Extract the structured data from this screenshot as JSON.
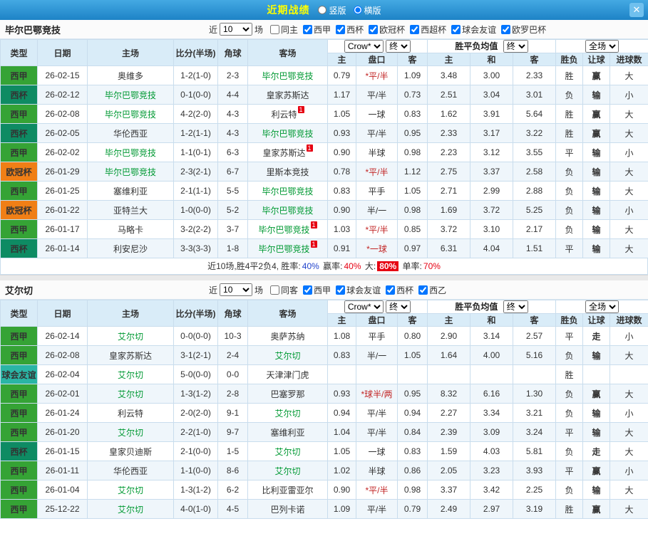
{
  "topbar": {
    "title": "近期战绩",
    "radios": [
      {
        "label": "竖版",
        "selected": false
      },
      {
        "label": "横版",
        "selected": true
      }
    ],
    "close_glyph": "✕"
  },
  "card_badge_text": "1",
  "colors": {
    "accent_blue": "#2491d6",
    "title_yellow": "#ffff00",
    "score_red": "#e60012",
    "focus_green": "#009933",
    "draw_blue": "#2244cc",
    "league": {
      "西甲": "#35a335",
      "西杯": "#0e8b63",
      "欧冠杯": "#f07f16",
      "球会友谊": "#2ab5a5"
    }
  },
  "filter_words": {
    "near": "近",
    "matches": "场"
  },
  "table_header": {
    "type": "类型",
    "date": "日期",
    "home": "主场",
    "score": "比分(半场)",
    "corner": "角球",
    "away": "客场",
    "odds_source": "Crow*",
    "final1": "终",
    "odds_cols": [
      "主",
      "盘口",
      "客"
    ],
    "avg_title": "胜平负均值",
    "final2": "终",
    "avg_cols": [
      "主",
      "和",
      "客"
    ],
    "scope": "全场",
    "result_cols": [
      "胜负",
      "让球",
      "进球数"
    ]
  },
  "sections": [
    {
      "team": "毕尔巴鄂竞技",
      "count": "10",
      "checkboxes": [
        {
          "label": "同主",
          "checked": false
        },
        {
          "label": "西甲",
          "checked": true
        },
        {
          "label": "西杯",
          "checked": true
        },
        {
          "label": "欧冠杯",
          "checked": true
        },
        {
          "label": "西超杯",
          "checked": true
        },
        {
          "label": "球会友谊",
          "checked": true
        },
        {
          "label": "欧罗巴杯",
          "checked": true
        }
      ],
      "rows": [
        {
          "league": "西甲",
          "date": "26-02-15",
          "home": "奥维多",
          "home_focus": false,
          "home_card": false,
          "score": "1-2(1-0)",
          "corner": "2-3",
          "away": "毕尔巴鄂竞技",
          "away_focus": true,
          "away_card": false,
          "odds": [
            "0.79",
            "*平/半",
            "1.09"
          ],
          "avg": [
            "3.48",
            "3.00",
            "2.33"
          ],
          "result": "胜",
          "handicap": "赢",
          "goals": "大"
        },
        {
          "league": "西杯",
          "date": "26-02-12",
          "home": "毕尔巴鄂竞技",
          "home_focus": true,
          "home_card": false,
          "score": "0-1(0-0)",
          "corner": "4-4",
          "away": "皇家苏斯达",
          "away_focus": false,
          "away_card": false,
          "odds": [
            "1.17",
            "平/半",
            "0.73"
          ],
          "avg": [
            "2.51",
            "3.04",
            "3.01"
          ],
          "result": "负",
          "handicap": "输",
          "goals": "小"
        },
        {
          "league": "西甲",
          "date": "26-02-08",
          "home": "毕尔巴鄂竞技",
          "home_focus": true,
          "home_card": false,
          "score": "4-2(2-0)",
          "corner": "4-3",
          "away": "利云特",
          "away_focus": false,
          "away_card": true,
          "odds": [
            "1.05",
            "一球",
            "0.83"
          ],
          "avg": [
            "1.62",
            "3.91",
            "5.64"
          ],
          "result": "胜",
          "handicap": "赢",
          "goals": "大"
        },
        {
          "league": "西杯",
          "date": "26-02-05",
          "home": "华伦西亚",
          "home_focus": false,
          "home_card": false,
          "score": "1-2(1-1)",
          "corner": "4-3",
          "away": "毕尔巴鄂竞技",
          "away_focus": true,
          "away_card": false,
          "odds": [
            "0.93",
            "平/半",
            "0.95"
          ],
          "avg": [
            "2.33",
            "3.17",
            "3.22"
          ],
          "result": "胜",
          "handicap": "赢",
          "goals": "大"
        },
        {
          "league": "西甲",
          "date": "26-02-02",
          "home": "毕尔巴鄂竞技",
          "home_focus": true,
          "home_card": false,
          "score": "1-1(0-1)",
          "corner": "6-3",
          "away": "皇家苏斯达",
          "away_focus": false,
          "away_card": true,
          "odds": [
            "0.90",
            "半球",
            "0.98"
          ],
          "avg": [
            "2.23",
            "3.12",
            "3.55"
          ],
          "result": "平",
          "handicap": "输",
          "goals": "小"
        },
        {
          "league": "欧冠杯",
          "date": "26-01-29",
          "home": "毕尔巴鄂竞技",
          "home_focus": true,
          "home_card": false,
          "score": "2-3(2-1)",
          "corner": "6-7",
          "away": "里斯本竞技",
          "away_focus": false,
          "away_card": false,
          "odds": [
            "0.78",
            "*平/半",
            "1.12"
          ],
          "avg": [
            "2.75",
            "3.37",
            "2.58"
          ],
          "result": "负",
          "handicap": "输",
          "goals": "大"
        },
        {
          "league": "西甲",
          "date": "26-01-25",
          "home": "塞维利亚",
          "home_focus": false,
          "home_card": false,
          "score": "2-1(1-1)",
          "corner": "5-5",
          "away": "毕尔巴鄂竞技",
          "away_focus": true,
          "away_card": false,
          "odds": [
            "0.83",
            "平手",
            "1.05"
          ],
          "avg": [
            "2.71",
            "2.99",
            "2.88"
          ],
          "result": "负",
          "handicap": "输",
          "goals": "大"
        },
        {
          "league": "欧冠杯",
          "date": "26-01-22",
          "home": "亚特兰大",
          "home_focus": false,
          "home_card": false,
          "score": "1-0(0-0)",
          "corner": "5-2",
          "away": "毕尔巴鄂竞技",
          "away_focus": true,
          "away_card": false,
          "odds": [
            "0.90",
            "半/一",
            "0.98"
          ],
          "avg": [
            "1.69",
            "3.72",
            "5.25"
          ],
          "result": "负",
          "handicap": "输",
          "goals": "小"
        },
        {
          "league": "西甲",
          "date": "26-01-17",
          "home": "马略卡",
          "home_focus": false,
          "home_card": false,
          "score": "3-2(2-2)",
          "corner": "3-7",
          "away": "毕尔巴鄂竞技",
          "away_focus": true,
          "away_card": true,
          "odds": [
            "1.03",
            "*平/半",
            "0.85"
          ],
          "avg": [
            "3.72",
            "3.10",
            "2.17"
          ],
          "result": "负",
          "handicap": "输",
          "goals": "大"
        },
        {
          "league": "西杯",
          "date": "26-01-14",
          "home": "利安尼沙",
          "home_focus": false,
          "home_card": false,
          "score": "3-3(3-3)",
          "corner": "1-8",
          "away": "毕尔巴鄂竞技",
          "away_focus": true,
          "away_card": true,
          "odds": [
            "0.91",
            "*一球",
            "0.97"
          ],
          "avg": [
            "6.31",
            "4.04",
            "1.51"
          ],
          "result": "平",
          "handicap": "输",
          "goals": "大"
        }
      ],
      "summary": [
        {
          "text": "近10场,胜4平2负4, 胜率:",
          "style": "plain"
        },
        {
          "text": "40%",
          "style": "blue"
        },
        {
          "text": " 赢率:",
          "style": "plain"
        },
        {
          "text": "40%",
          "style": "red"
        },
        {
          "text": " 大:",
          "style": "plain"
        },
        {
          "text": "80%",
          "style": "badge"
        },
        {
          "text": " 单率:",
          "style": "plain"
        },
        {
          "text": "70%",
          "style": "red"
        }
      ]
    },
    {
      "team": "艾尔切",
      "count": "10",
      "checkboxes": [
        {
          "label": "同客",
          "checked": false
        },
        {
          "label": "西甲",
          "checked": true
        },
        {
          "label": "球会友谊",
          "checked": true
        },
        {
          "label": "西杯",
          "checked": true
        },
        {
          "label": "西乙",
          "checked": true
        }
      ],
      "rows": [
        {
          "league": "西甲",
          "date": "26-02-14",
          "home": "艾尔切",
          "home_focus": true,
          "home_card": false,
          "score": "0-0(0-0)",
          "corner": "10-3",
          "away": "奥萨苏纳",
          "away_focus": false,
          "away_card": false,
          "odds": [
            "1.08",
            "平手",
            "0.80"
          ],
          "avg": [
            "2.90",
            "3.14",
            "2.57"
          ],
          "result": "平",
          "handicap": "走",
          "goals": "小"
        },
        {
          "league": "西甲",
          "date": "26-02-08",
          "home": "皇家苏斯达",
          "home_focus": false,
          "home_card": false,
          "score": "3-1(2-1)",
          "corner": "2-4",
          "away": "艾尔切",
          "away_focus": true,
          "away_card": false,
          "odds": [
            "0.83",
            "半/一",
            "1.05"
          ],
          "avg": [
            "1.64",
            "4.00",
            "5.16"
          ],
          "result": "负",
          "handicap": "输",
          "goals": "大"
        },
        {
          "league": "球会友谊",
          "date": "26-02-04",
          "home": "艾尔切",
          "home_focus": true,
          "home_card": false,
          "score": "5-0(0-0)",
          "corner": "0-0",
          "away": "天津津门虎",
          "away_focus": false,
          "away_card": false,
          "odds": [
            "",
            "",
            ""
          ],
          "avg": [
            "",
            "",
            ""
          ],
          "result": "胜",
          "handicap": "",
          "goals": ""
        },
        {
          "league": "西甲",
          "date": "26-02-01",
          "home": "艾尔切",
          "home_focus": true,
          "home_card": false,
          "score": "1-3(1-2)",
          "corner": "2-8",
          "away": "巴塞罗那",
          "away_focus": false,
          "away_card": false,
          "odds": [
            "0.93",
            "*球半/两",
            "0.95"
          ],
          "avg": [
            "8.32",
            "6.16",
            "1.30"
          ],
          "result": "负",
          "handicap": "赢",
          "goals": "大"
        },
        {
          "league": "西甲",
          "date": "26-01-24",
          "home": "利云特",
          "home_focus": false,
          "home_card": false,
          "score": "2-0(2-0)",
          "corner": "9-1",
          "away": "艾尔切",
          "away_focus": true,
          "away_card": false,
          "odds": [
            "0.94",
            "平/半",
            "0.94"
          ],
          "avg": [
            "2.27",
            "3.34",
            "3.21"
          ],
          "result": "负",
          "handicap": "输",
          "goals": "小"
        },
        {
          "league": "西甲",
          "date": "26-01-20",
          "home": "艾尔切",
          "home_focus": true,
          "home_card": false,
          "score": "2-2(1-0)",
          "corner": "9-7",
          "away": "塞维利亚",
          "away_focus": false,
          "away_card": false,
          "odds": [
            "1.04",
            "平/半",
            "0.84"
          ],
          "avg": [
            "2.39",
            "3.09",
            "3.24"
          ],
          "result": "平",
          "handicap": "输",
          "goals": "大"
        },
        {
          "league": "西杯",
          "date": "26-01-15",
          "home": "皇家贝迪斯",
          "home_focus": false,
          "home_card": false,
          "score": "2-1(0-0)",
          "corner": "1-5",
          "away": "艾尔切",
          "away_focus": true,
          "away_card": false,
          "odds": [
            "1.05",
            "一球",
            "0.83"
          ],
          "avg": [
            "1.59",
            "4.03",
            "5.81"
          ],
          "result": "负",
          "handicap": "走",
          "goals": "大"
        },
        {
          "league": "西甲",
          "date": "26-01-11",
          "home": "华伦西亚",
          "home_focus": false,
          "home_card": false,
          "score": "1-1(0-0)",
          "corner": "8-6",
          "away": "艾尔切",
          "away_focus": true,
          "away_card": false,
          "odds": [
            "1.02",
            "半球",
            "0.86"
          ],
          "avg": [
            "2.05",
            "3.23",
            "3.93"
          ],
          "result": "平",
          "handicap": "赢",
          "goals": "小"
        },
        {
          "league": "西甲",
          "date": "26-01-04",
          "home": "艾尔切",
          "home_focus": true,
          "home_card": false,
          "score": "1-3(1-2)",
          "corner": "6-2",
          "away": "比利亚雷亚尔",
          "away_focus": false,
          "away_card": false,
          "odds": [
            "0.90",
            "*平/半",
            "0.98"
          ],
          "avg": [
            "3.37",
            "3.42",
            "2.25"
          ],
          "result": "负",
          "handicap": "输",
          "goals": "大"
        },
        {
          "league": "西甲",
          "date": "25-12-22",
          "home": "艾尔切",
          "home_focus": true,
          "home_card": false,
          "score": "4-0(1-0)",
          "corner": "4-5",
          "away": "巴列卡诺",
          "away_focus": false,
          "away_card": false,
          "odds": [
            "1.09",
            "平/半",
            "0.79"
          ],
          "avg": [
            "2.49",
            "2.97",
            "3.19"
          ],
          "result": "胜",
          "handicap": "赢",
          "goals": "大"
        }
      ],
      "summary": []
    }
  ]
}
